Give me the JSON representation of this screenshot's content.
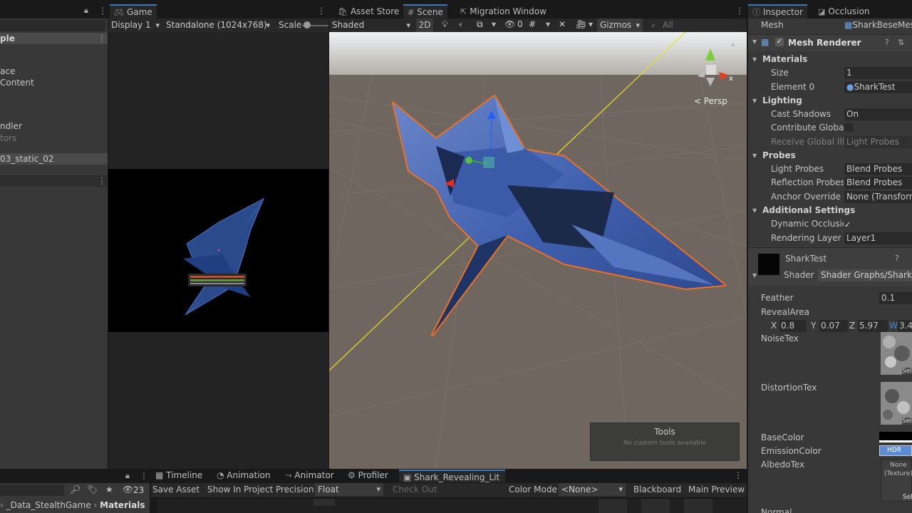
{
  "hierarchy": {
    "row_frag": "ple",
    "items": [
      "",
      "ace",
      "Content",
      "",
      "",
      "ndler",
      "tors",
      "",
      "03_static_02"
    ]
  },
  "game": {
    "tab_label": "Game",
    "display": "Display 1",
    "resolution": "Standalone (1024x768)",
    "scale_label": "Scale"
  },
  "scene": {
    "tabs": [
      "Asset Store",
      "Scene",
      "Migration Window"
    ],
    "shading": "Shaded",
    "btn_2d": "2D",
    "hidden_count": "0",
    "gizmos": "Gizmos",
    "search_placeholder": "All",
    "persp": "< Persp",
    "axis_x": "x",
    "tools_title": "Tools",
    "tools_empty": "No custom tools available"
  },
  "inspector": {
    "tabs": [
      "Inspector",
      "Occlusion"
    ],
    "mesh_label": "Mesh",
    "mesh_value": "SharkBeseMesh",
    "component": "Mesh Renderer",
    "materials_header": "Materials",
    "size_label": "Size",
    "size_value": "1",
    "element0_label": "Element 0",
    "element0_value": "SharkTest",
    "lighting_header": "Lighting",
    "cast_shadows_label": "Cast Shadows",
    "cast_shadows_value": "On",
    "contribute_gi_label": "Contribute Global Illumination",
    "receive_gi_label": "Receive Global Illumination",
    "receive_gi_value": "Light Probes",
    "probes_header": "Probes",
    "light_probes_label": "Light Probes",
    "light_probes_value": "Blend Probes",
    "reflection_probes_label": "Reflection Probes",
    "reflection_probes_value": "Blend Probes",
    "anchor_override_label": "Anchor Override",
    "anchor_override_value": "None (Transform)",
    "additional_header": "Additional Settings",
    "dynamic_occlusion_label": "Dynamic Occlusion",
    "rendering_layer_label": "Rendering Layer Mask",
    "rendering_layer_value": "Layer1",
    "material_name": "SharkTest",
    "shader_label": "Shader",
    "shader_value": "Shader Graphs/Shark_Revealing_Lit",
    "feather_label": "Feather",
    "feather_value": "0.1",
    "reveal_label": "RevealArea",
    "reveal": {
      "x_label": "X",
      "x": "0.8",
      "y_label": "Y",
      "y": "0.07",
      "z_label": "Z",
      "z": "5.97",
      "w_label": "W",
      "w": "3.4"
    },
    "noise_label": "NoiseTex",
    "distortion_label": "DistortionTex",
    "base_color_label": "BaseColor",
    "emission_label": "EmissionColor",
    "emission_badge": "HDR",
    "albedo_label": "AlbedoTex",
    "albedo_value": "None (Texture)",
    "select_label": "Sele",
    "normal_label": "Normal"
  },
  "bottom": {
    "tabs": [
      "Timeline",
      "Animation",
      "Animator",
      "Profiler",
      "Shark_Revealing_Lit"
    ],
    "hidden_count": "23",
    "breadcrumb_a": "_Data_StealthGame",
    "breadcrumb_b": "Materials",
    "save_asset": "Save Asset",
    "show_in_project": "Show In Project",
    "precision_label": "Precision",
    "precision_value": "Float",
    "check_out": "Check Out",
    "color_mode_label": "Color Mode",
    "color_mode_value": "<None>",
    "blackboard": "Blackboard",
    "main_preview": "Main Preview"
  },
  "colors": {
    "accent": "#3a79bb",
    "selection_outline": "#f07020",
    "scene_sky": "#c7cbcf",
    "scene_ground": "#6e665f"
  }
}
